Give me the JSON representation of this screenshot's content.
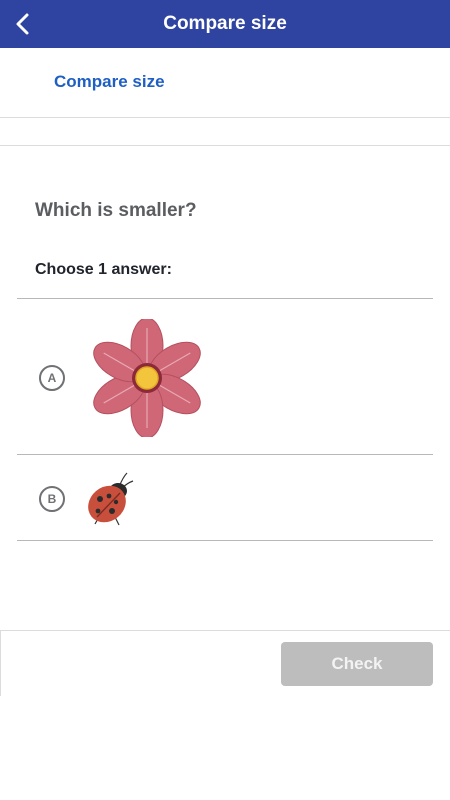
{
  "header": {
    "title": "Compare size",
    "back_icon": "chevron-left-icon",
    "background_color": "#2f43a0"
  },
  "subnav": {
    "link_label": "Compare size",
    "link_color": "#1f5fc4"
  },
  "question": {
    "prompt": "Which is smaller?",
    "instruction": "Choose 1 answer:",
    "choices": [
      {
        "letter": "A",
        "image": "flower-image"
      },
      {
        "letter": "B",
        "image": "ladybug-image"
      }
    ]
  },
  "footer": {
    "check_label": "Check",
    "check_state": "disabled"
  }
}
